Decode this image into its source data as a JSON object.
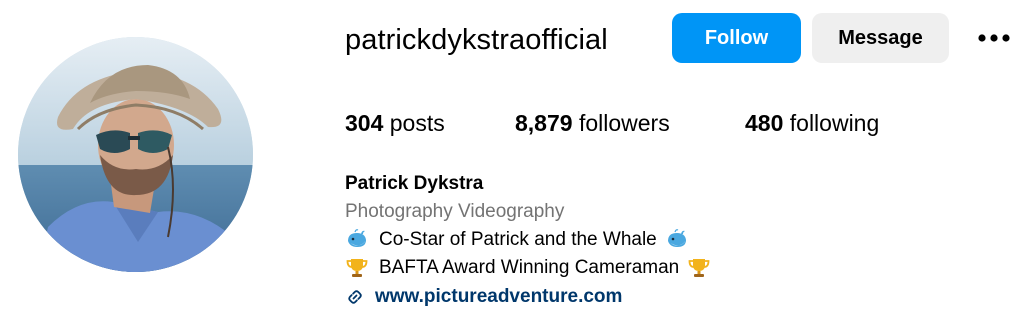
{
  "profile": {
    "username": "patrickdykstraofficial",
    "follow_label": "Follow",
    "message_label": "Message",
    "more_icon": "more-options-icon",
    "avatar_icon": "profile-photo-avatar"
  },
  "stats": {
    "posts_count": "304",
    "posts_label": "posts",
    "followers_count": "8,879",
    "followers_label": "followers",
    "following_count": "480",
    "following_label": "following"
  },
  "bio": {
    "full_name": "Patrick Dykstra",
    "category": "Photography Videography",
    "line1": "Co-Star of Patrick and the Whale",
    "line1_icon": "whale-emoji-icon",
    "line2": "BAFTA Award Winning Cameraman",
    "line2_icon": "trophy-emoji-icon",
    "link": "www.pictureadventure.com",
    "link_icon": "link-icon"
  },
  "colors": {
    "follow_button": "#0095f6",
    "message_button": "#efefef",
    "category_text": "#737373",
    "link_text": "#00376b"
  }
}
